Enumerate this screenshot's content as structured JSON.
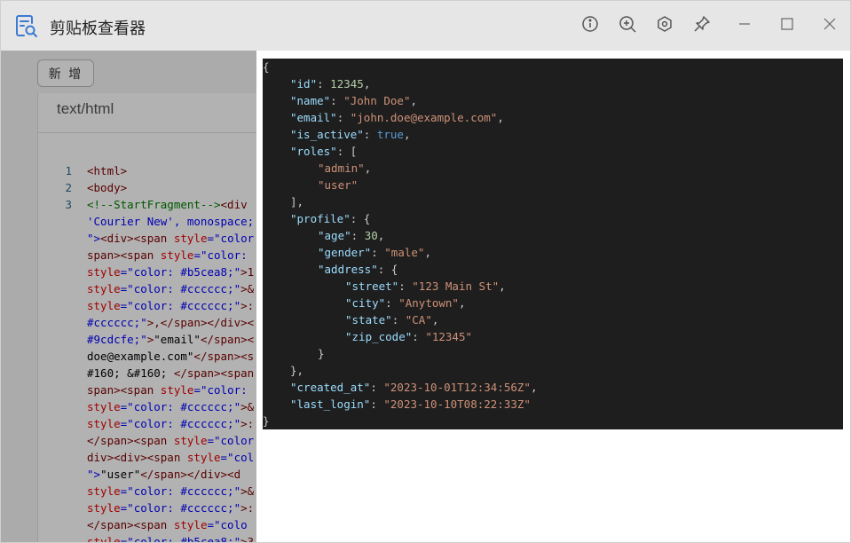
{
  "window": {
    "title": "剪贴板查看器"
  },
  "titlebar": {
    "buttons": [
      {
        "name": "info-button",
        "icon": "info-icon"
      },
      {
        "name": "zoom-in-button",
        "icon": "zoom-in-icon"
      },
      {
        "name": "settings-button",
        "icon": "hexagon-settings-icon"
      },
      {
        "name": "pin-button",
        "icon": "pin-icon"
      },
      {
        "name": "minimize-button",
        "icon": "minimize-icon"
      },
      {
        "name": "maximize-button",
        "icon": "maximize-icon"
      },
      {
        "name": "close-button",
        "icon": "close-icon"
      }
    ]
  },
  "toolbar": {
    "add_label": "新 增"
  },
  "content": {
    "mime_type": "text/html"
  },
  "code_lines": [
    {
      "num": "1",
      "parts": [
        {
          "t": "<html>",
          "c": "tag"
        }
      ]
    },
    {
      "num": "2",
      "parts": [
        {
          "t": "<body>",
          "c": "tag"
        }
      ]
    },
    {
      "num": "3",
      "parts": [
        {
          "t": "<!--StartFragment-->",
          "c": "comment"
        },
        {
          "t": "<div ",
          "c": "tag"
        }
      ]
    },
    {
      "num": "",
      "parts": [
        {
          "t": "'Courier New', monospace;",
          "c": "str"
        }
      ]
    },
    {
      "num": "",
      "parts": [
        {
          "t": "\">",
          "c": "str"
        },
        {
          "t": "<div><span ",
          "c": "tag"
        },
        {
          "t": "style",
          "c": "attr"
        },
        {
          "t": "=\"color",
          "c": "str"
        }
      ]
    },
    {
      "num": "",
      "parts": [
        {
          "t": "span><span ",
          "c": "tag"
        },
        {
          "t": "style",
          "c": "attr"
        },
        {
          "t": "=\"color: ",
          "c": "str"
        }
      ]
    },
    {
      "num": "",
      "parts": [
        {
          "t": "style",
          "c": "attr"
        },
        {
          "t": "=\"color: #b5cea8;\"",
          "c": "str"
        },
        {
          "t": ">1",
          "c": "tag"
        }
      ]
    },
    {
      "num": "",
      "parts": [
        {
          "t": "style",
          "c": "attr"
        },
        {
          "t": "=\"color: #cccccc;\"",
          "c": "str"
        },
        {
          "t": ">&",
          "c": "tag"
        }
      ]
    },
    {
      "num": "",
      "parts": [
        {
          "t": "style",
          "c": "attr"
        },
        {
          "t": "=\"color: #cccccc;\"",
          "c": "str"
        },
        {
          "t": ">:",
          "c": "tag"
        }
      ]
    },
    {
      "num": "",
      "parts": [
        {
          "t": "#cccccc;\"",
          "c": "str"
        },
        {
          "t": ">,</span></div><",
          "c": "tag"
        }
      ]
    },
    {
      "num": "",
      "parts": [
        {
          "t": "#9cdcfe;\"",
          "c": "str"
        },
        {
          "t": ">",
          "c": "tag"
        },
        {
          "t": "\"email\"",
          "c": "text"
        },
        {
          "t": "</span><",
          "c": "tag"
        }
      ]
    },
    {
      "num": "",
      "parts": [
        {
          "t": "doe@example.com\"",
          "c": "text"
        },
        {
          "t": "</span><s",
          "c": "tag"
        }
      ]
    },
    {
      "num": "",
      "parts": [
        {
          "t": "#160; &#160; ",
          "c": "text"
        },
        {
          "t": "</span><span",
          "c": "tag"
        }
      ]
    },
    {
      "num": "",
      "parts": [
        {
          "t": "span><span ",
          "c": "tag"
        },
        {
          "t": "style",
          "c": "attr"
        },
        {
          "t": "=\"color: ",
          "c": "str"
        }
      ]
    },
    {
      "num": "",
      "parts": [
        {
          "t": "style",
          "c": "attr"
        },
        {
          "t": "=\"color: #cccccc;\"",
          "c": "str"
        },
        {
          "t": ">&",
          "c": "tag"
        }
      ]
    },
    {
      "num": "",
      "parts": [
        {
          "t": "style",
          "c": "attr"
        },
        {
          "t": "=\"color: #cccccc;\"",
          "c": "str"
        },
        {
          "t": ">:",
          "c": "tag"
        }
      ]
    },
    {
      "num": "",
      "parts": [
        {
          "t": "</span><span ",
          "c": "tag"
        },
        {
          "t": "style",
          "c": "attr"
        },
        {
          "t": "=\"color",
          "c": "str"
        }
      ]
    },
    {
      "num": "",
      "parts": [
        {
          "t": "div><div><span ",
          "c": "tag"
        },
        {
          "t": "style",
          "c": "attr"
        },
        {
          "t": "=\"col",
          "c": "str"
        }
      ]
    },
    {
      "num": "",
      "parts": [
        {
          "t": "\">",
          "c": "str"
        },
        {
          "t": "\"user\"",
          "c": "text"
        },
        {
          "t": "</span></div><d",
          "c": "tag"
        }
      ]
    },
    {
      "num": "",
      "parts": [
        {
          "t": "style",
          "c": "attr"
        },
        {
          "t": "=\"color: #cccccc;\"",
          "c": "str"
        },
        {
          "t": ">&",
          "c": "tag"
        }
      ]
    },
    {
      "num": "",
      "parts": [
        {
          "t": "style",
          "c": "attr"
        },
        {
          "t": "=\"color: #cccccc;\"",
          "c": "str"
        },
        {
          "t": ">:",
          "c": "tag"
        }
      ]
    },
    {
      "num": "",
      "parts": [
        {
          "t": "</span><span ",
          "c": "tag"
        },
        {
          "t": "style",
          "c": "attr"
        },
        {
          "t": "=\"colo",
          "c": "str"
        }
      ]
    },
    {
      "num": "",
      "parts": [
        {
          "t": "style",
          "c": "attr"
        },
        {
          "t": "=\"color: #b5cea8;\"",
          "c": "str"
        },
        {
          "t": ">3",
          "c": "tag"
        }
      ]
    }
  ],
  "json_lines": [
    {
      "indent": 0,
      "parts": [
        {
          "t": "{",
          "c": "punc"
        }
      ]
    },
    {
      "indent": 1,
      "parts": [
        {
          "t": "\"id\"",
          "c": "key"
        },
        {
          "t": ": ",
          "c": "punc"
        },
        {
          "t": "12345",
          "c": "num"
        },
        {
          "t": ",",
          "c": "punc"
        }
      ]
    },
    {
      "indent": 1,
      "parts": [
        {
          "t": "\"name\"",
          "c": "key"
        },
        {
          "t": ": ",
          "c": "punc"
        },
        {
          "t": "\"John Doe\"",
          "c": "str"
        },
        {
          "t": ",",
          "c": "punc"
        }
      ]
    },
    {
      "indent": 1,
      "parts": [
        {
          "t": "\"email\"",
          "c": "key"
        },
        {
          "t": ": ",
          "c": "punc"
        },
        {
          "t": "\"john.doe@example.com\"",
          "c": "str"
        },
        {
          "t": ",",
          "c": "punc"
        }
      ]
    },
    {
      "indent": 1,
      "parts": [
        {
          "t": "\"is_active\"",
          "c": "key"
        },
        {
          "t": ": ",
          "c": "punc"
        },
        {
          "t": "true",
          "c": "bool"
        },
        {
          "t": ",",
          "c": "punc"
        }
      ]
    },
    {
      "indent": 1,
      "parts": [
        {
          "t": "\"roles\"",
          "c": "key"
        },
        {
          "t": ": [",
          "c": "punc"
        }
      ]
    },
    {
      "indent": 2,
      "parts": [
        {
          "t": "\"admin\"",
          "c": "str"
        },
        {
          "t": ",",
          "c": "punc"
        }
      ]
    },
    {
      "indent": 2,
      "parts": [
        {
          "t": "\"user\"",
          "c": "str"
        }
      ]
    },
    {
      "indent": 1,
      "parts": [
        {
          "t": "],",
          "c": "punc"
        }
      ]
    },
    {
      "indent": 1,
      "parts": [
        {
          "t": "\"profile\"",
          "c": "key"
        },
        {
          "t": ": {",
          "c": "punc"
        }
      ]
    },
    {
      "indent": 2,
      "parts": [
        {
          "t": "\"age\"",
          "c": "key"
        },
        {
          "t": ": ",
          "c": "punc"
        },
        {
          "t": "30",
          "c": "num"
        },
        {
          "t": ",",
          "c": "punc"
        }
      ]
    },
    {
      "indent": 2,
      "parts": [
        {
          "t": "\"gender\"",
          "c": "key"
        },
        {
          "t": ": ",
          "c": "punc"
        },
        {
          "t": "\"male\"",
          "c": "str"
        },
        {
          "t": ",",
          "c": "punc"
        }
      ]
    },
    {
      "indent": 2,
      "parts": [
        {
          "t": "\"address\"",
          "c": "key"
        },
        {
          "t": ": {",
          "c": "punc"
        }
      ]
    },
    {
      "indent": 3,
      "parts": [
        {
          "t": "\"street\"",
          "c": "key"
        },
        {
          "t": ": ",
          "c": "punc"
        },
        {
          "t": "\"123 Main St\"",
          "c": "str"
        },
        {
          "t": ",",
          "c": "punc"
        }
      ]
    },
    {
      "indent": 3,
      "parts": [
        {
          "t": "\"city\"",
          "c": "key"
        },
        {
          "t": ": ",
          "c": "punc"
        },
        {
          "t": "\"Anytown\"",
          "c": "str"
        },
        {
          "t": ",",
          "c": "punc"
        }
      ]
    },
    {
      "indent": 3,
      "parts": [
        {
          "t": "\"state\"",
          "c": "key"
        },
        {
          "t": ": ",
          "c": "punc"
        },
        {
          "t": "\"CA\"",
          "c": "str"
        },
        {
          "t": ",",
          "c": "punc"
        }
      ]
    },
    {
      "indent": 3,
      "parts": [
        {
          "t": "\"zip_code\"",
          "c": "key"
        },
        {
          "t": ": ",
          "c": "punc"
        },
        {
          "t": "\"12345\"",
          "c": "str"
        }
      ]
    },
    {
      "indent": 2,
      "parts": [
        {
          "t": "}",
          "c": "punc"
        }
      ]
    },
    {
      "indent": 1,
      "parts": [
        {
          "t": "},",
          "c": "punc"
        }
      ]
    },
    {
      "indent": 1,
      "parts": [
        {
          "t": "\"created_at\"",
          "c": "key"
        },
        {
          "t": ": ",
          "c": "punc"
        },
        {
          "t": "\"2023-10-01T12:34:56Z\"",
          "c": "str"
        },
        {
          "t": ",",
          "c": "punc"
        }
      ]
    },
    {
      "indent": 1,
      "parts": [
        {
          "t": "\"last_login\"",
          "c": "key"
        },
        {
          "t": ": ",
          "c": "punc"
        },
        {
          "t": "\"2023-10-10T08:22:33Z\"",
          "c": "str"
        }
      ]
    },
    {
      "indent": 0,
      "parts": [
        {
          "t": "}",
          "c": "punc"
        }
      ]
    }
  ],
  "colors": {
    "titlebar_bg": "#e6e6e6",
    "accent_icon": "#3b7bd4",
    "code_bg": "#1e1e1e",
    "json_key": "#9cdcfe",
    "json_string": "#ce9178",
    "json_number": "#b5cea8",
    "json_bool": "#569cd6"
  }
}
